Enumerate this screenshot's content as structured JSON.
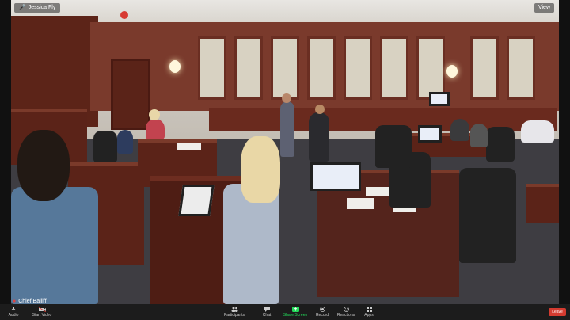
{
  "overlay": {
    "name_tag": "Jessica Fly",
    "view_label": "View"
  },
  "speaker": {
    "name": "Chief Bailiff"
  },
  "toolbar": {
    "items": [
      {
        "label": "Audio",
        "icon": "microphone-icon"
      },
      {
        "label": "Start Video",
        "icon": "video-camera-icon"
      },
      {
        "label": "Participants",
        "icon": "participants-icon"
      },
      {
        "label": "Chat",
        "icon": "chat-icon"
      },
      {
        "label": "Share Screen",
        "icon": "share-screen-icon",
        "color": "#23d959"
      },
      {
        "label": "Record",
        "icon": "record-icon"
      },
      {
        "label": "Reactions",
        "icon": "reactions-icon"
      },
      {
        "label": "Apps",
        "icon": "apps-icon"
      }
    ],
    "leave_label": "Leave",
    "leave_color": "#d43b30"
  }
}
